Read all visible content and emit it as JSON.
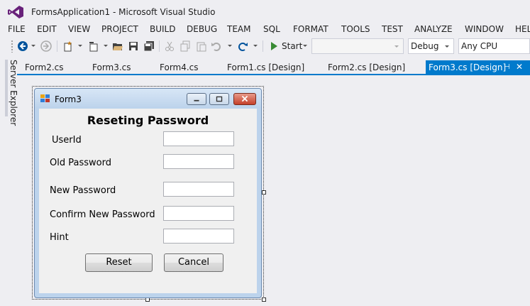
{
  "window": {
    "title": "FormsApplication1 - Microsoft Visual Studio"
  },
  "menu": [
    "FILE",
    "EDIT",
    "VIEW",
    "PROJECT",
    "BUILD",
    "DEBUG",
    "TEAM",
    "SQL",
    "FORMAT",
    "TOOLS",
    "TEST",
    "ANALYZE",
    "WINDOW",
    "HEL"
  ],
  "toolbar": {
    "start_label": "Start",
    "target_combo_value": "",
    "configuration": "Debug",
    "platform": "Any CPU"
  },
  "side_panel": {
    "label": "Server Explorer"
  },
  "tabs": [
    {
      "label": "Form2.cs"
    },
    {
      "label": "Form3.cs"
    },
    {
      "label": "Form4.cs"
    },
    {
      "label": "Form1.cs [Design]"
    },
    {
      "label": "Form2.cs [Design]"
    },
    {
      "label": "Form3.cs [Design]"
    }
  ],
  "form": {
    "title": "Form3",
    "heading": "Reseting Password",
    "fields": [
      {
        "label": "UserId",
        "value": ""
      },
      {
        "label": "Old Password",
        "value": ""
      },
      {
        "label": "New Password",
        "value": ""
      },
      {
        "label": "Confirm New Password",
        "value": ""
      },
      {
        "label": "Hint",
        "value": ""
      }
    ],
    "reset_label": "Reset",
    "cancel_label": "Cancel"
  },
  "colors": {
    "accent": "#007acc",
    "background": "#eeeef2",
    "form_frame": "#bcd3ec"
  }
}
